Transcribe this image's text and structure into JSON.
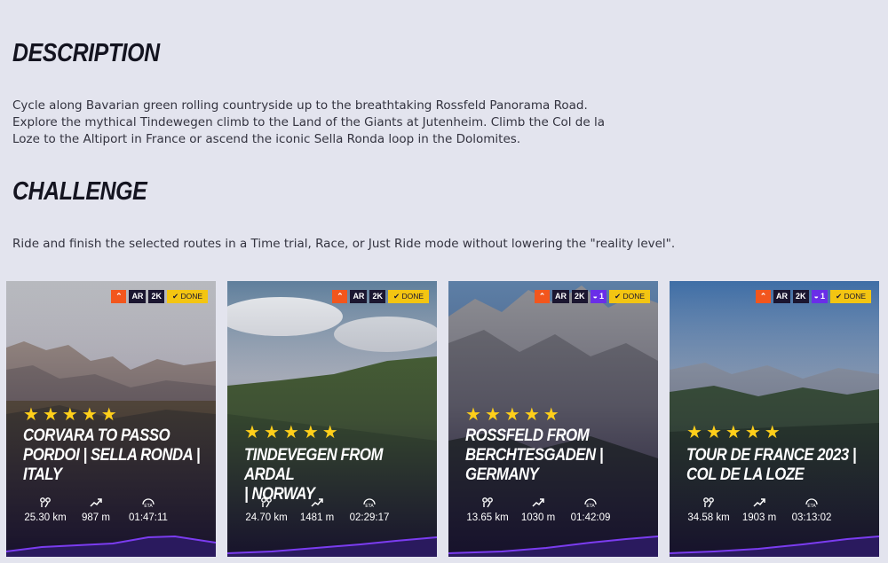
{
  "description": {
    "heading": "DESCRIPTION",
    "lines": [
      "Cycle along Bavarian green rolling countryside up to the breathtaking Rossfeld Panorama Road.",
      "Explore the mythical Tindewegen climb to the Land of the Giants at Jutenheim. Climb the Col de la",
      "Loze to the Altiport in France or ascend the iconic Sella Ronda loop in the Dolomites."
    ]
  },
  "challenge": {
    "heading": "CHALLENGE",
    "text": "Ride and finish the selected routes in a Time trial, Race, or Just Ride mode without lowering the \"reality level\"."
  },
  "colors": {
    "accent_yellow": "#f3c512",
    "strava_orange": "#f2561d",
    "purple": "#6a2ee8",
    "profile_line": "#7b3cf0"
  },
  "cards": [
    {
      "badges": {
        "ar": "AR",
        "res": "2K",
        "count": "",
        "done": "DONE"
      },
      "title_lines": [
        "CORVARA TO PASSO",
        "PORDOI |  SELLA RONDA |",
        "ITALY"
      ],
      "distance": "25.30 km",
      "elevation": "987 m",
      "eta": "01:47:11",
      "rating": 5
    },
    {
      "badges": {
        "ar": "AR",
        "res": "2K",
        "count": "",
        "done": "DONE"
      },
      "title_lines": [
        "TINDEVEGEN FROM ARDAL",
        "|  NORWAY"
      ],
      "distance": "24.70 km",
      "elevation": "1481 m",
      "eta": "02:29:17",
      "rating": 5
    },
    {
      "badges": {
        "ar": "AR",
        "res": "2K",
        "count": "1",
        "done": "DONE"
      },
      "title_lines": [
        "ROSSFELD FROM",
        "BERCHTESGADEN |",
        "GERMANY"
      ],
      "distance": "13.65 km",
      "elevation": "1030 m",
      "eta": "01:42:09",
      "rating": 5
    },
    {
      "badges": {
        "ar": "AR",
        "res": "2K",
        "count": "1",
        "done": "DONE"
      },
      "title_lines": [
        "TOUR DE FRANCE 2023 |",
        "COL DE LA LOZE"
      ],
      "distance": "34.58 km",
      "elevation": "1903 m",
      "eta": "03:13:02",
      "rating": 5
    }
  ]
}
